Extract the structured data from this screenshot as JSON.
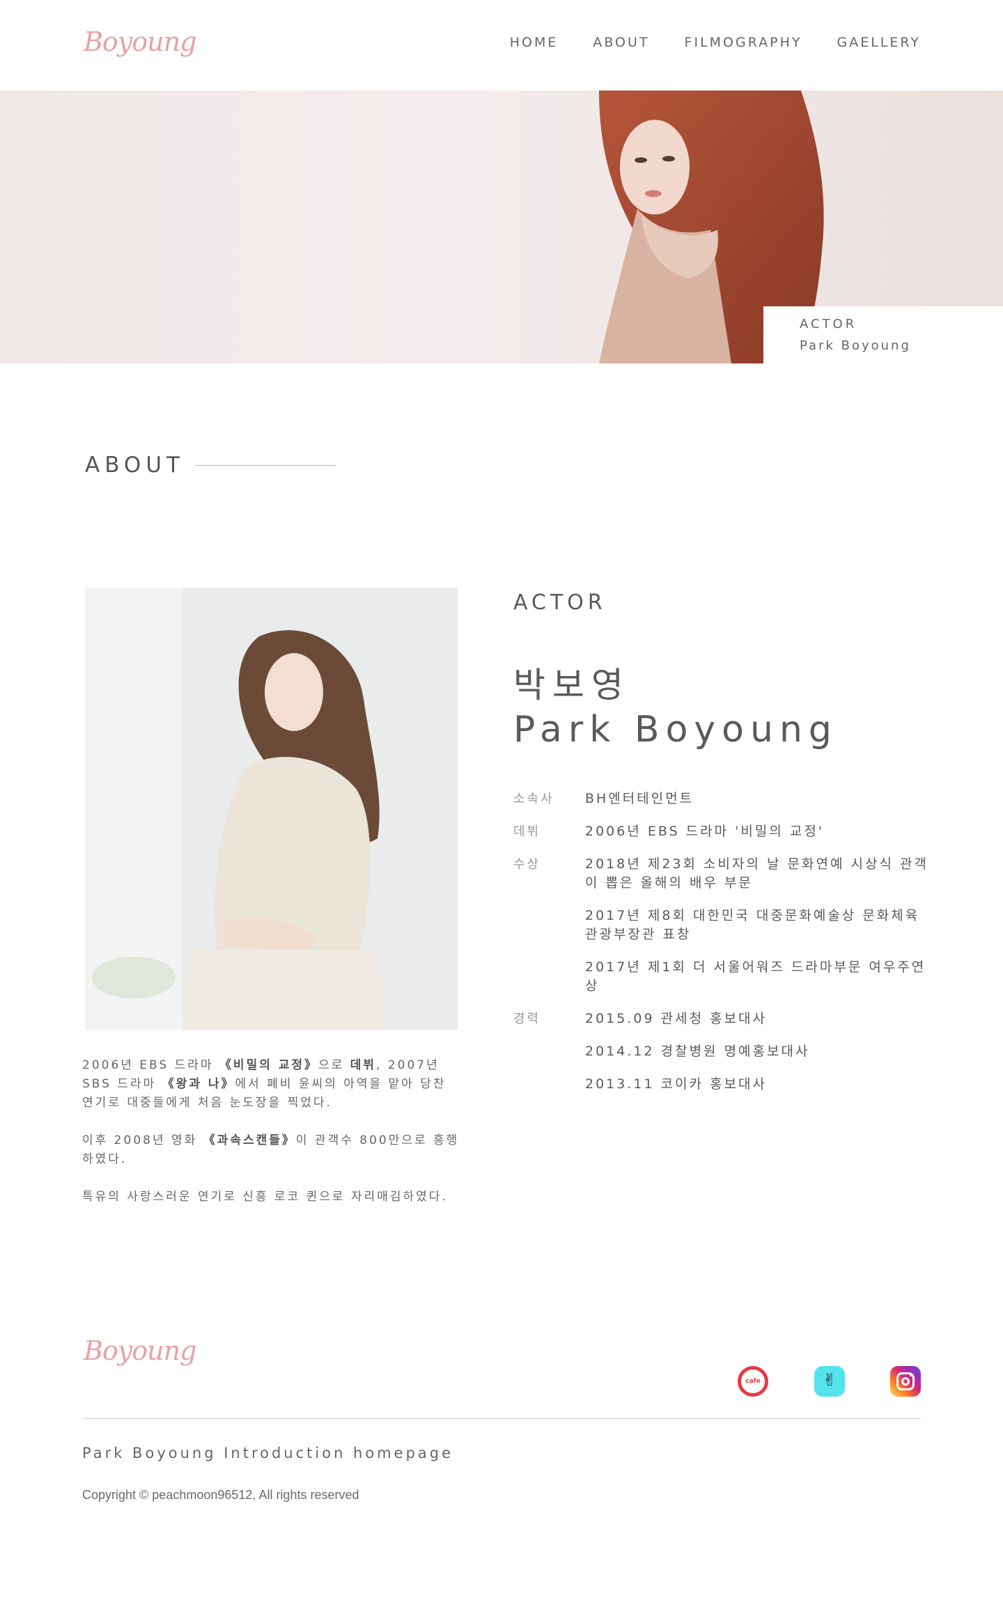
{
  "header": {
    "logo": "Boyoung",
    "nav": [
      "HOME",
      "ABOUT",
      "FILMOGRAPHY",
      "GAELLERY"
    ]
  },
  "hero": {
    "caption_line1": "ACTOR",
    "caption_line2": "Park Boyoung"
  },
  "about": {
    "heading": "ABOUT"
  },
  "bio": {
    "p1_a": "2006년 EBS 드라마 ",
    "p1_b": "《비밀의 교정》",
    "p1_c": "으로 ",
    "p1_d": "데뷔",
    "p1_e": ", 2007년 SBS 드라마 ",
    "p1_f": "《왕과 나》",
    "p1_g": "에서 폐비 윤씨의 아역을 맡아 당찬 연기로 대중들에게 처음 눈도장을 찍었다.",
    "p2_a": "이후 2008년 영화 ",
    "p2_b": "《과속스캔들》",
    "p2_c": "이 관객수 800만으로 흥행하였다.",
    "p3": "특유의 사랑스러운 연기로 신흥 로코 퀸으로 자리매김하였다."
  },
  "profile": {
    "role": "ACTOR",
    "name_ko": "박보영",
    "name_en": "Park Boyoung",
    "agency_label": "소속사",
    "agency": "BH엔터테인먼트",
    "debut_label": "데뷔",
    "debut": "2006년 EBS 드라마 '비밀의 교정'",
    "awards_label": "수상",
    "awards": [
      "2018년 제23회 소비자의 날 문화연예 시상식 관객이 뽑은 올해의 배우 부문",
      "2017년 제8회 대한민국 대중문화예술상 문화체육관광부장관 표창",
      "2017년 제1회 더 서울어워즈 드라마부문 여우주연상"
    ],
    "career_label": "경력",
    "career": [
      "2015.09 관세청 홍보대사",
      "2014.12 경찰병원 명예홍보대사",
      "2013.11 코이카 홍보대사"
    ]
  },
  "footer": {
    "logo": "Boyoung",
    "cafe_icon_text": "cafe",
    "title": "Park Boyoung Introduction homepage",
    "copyright": "Copyright © peachmoon96512, All rights reserved"
  },
  "colors": {
    "accent": "#e9a0a3",
    "text": "#5e5e5e"
  }
}
